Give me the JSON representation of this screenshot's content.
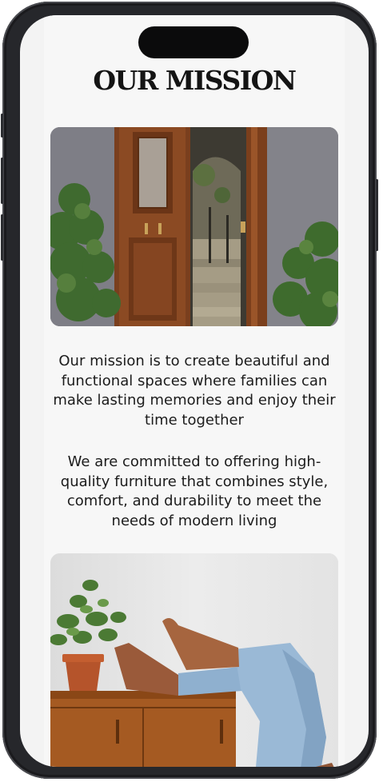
{
  "page": {
    "title": "OUR MISSION",
    "paragraphs": [
      "Our mission is to create beautiful and functional spaces where families can make lasting memories and enjoy their time together",
      "We are committed to offering high-quality furniture that combines style, comfort, and durability to meet the needs of modern living"
    ]
  },
  "images": {
    "hero": "wooden-door-courtyard-photo",
    "lifestyle": "plant-sideboard-feet-photo"
  },
  "colors": {
    "background": "#f7f7f7",
    "text": "#1c1c1c",
    "phone_frame": "#26272b"
  }
}
